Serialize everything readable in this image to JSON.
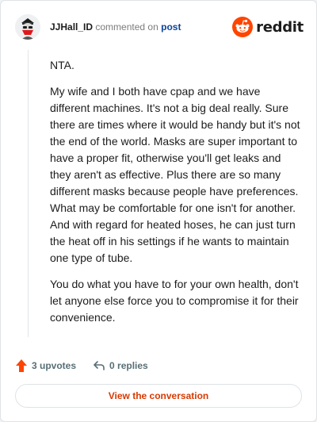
{
  "comment": {
    "username": "JJHall_ID",
    "commented_on_text": "commented on",
    "post_link_text": "post",
    "paragraphs": [
      "NTA.",
      "My wife and I both have cpap and we have different machines. It's not a big deal really. Sure there are times where it would be handy but it's not the end of the world. Masks are super important to have a proper fit, otherwise you'll get leaks and they aren't as effective. Plus there are so many different masks because people have preferences. What may be comfortable for one isn't for another. And with regard for heated hoses, he can just turn the heat off in his settings if he wants to maintain one type of tube.",
      "You do what you have to for your own health, don't let anyone else force you to compromise it for their convenience."
    ]
  },
  "brand": {
    "wordmark": "reddit",
    "accent_color": "#ff4500"
  },
  "actions": {
    "upvotes": "3 upvotes",
    "replies": "0 replies"
  },
  "view_button": {
    "label": "View the conversation"
  },
  "icons": {
    "avatar": "user-avatar-icon",
    "logo": "reddit-alien-icon",
    "upvote": "upvote-arrow-icon",
    "reply": "reply-arrow-icon"
  }
}
